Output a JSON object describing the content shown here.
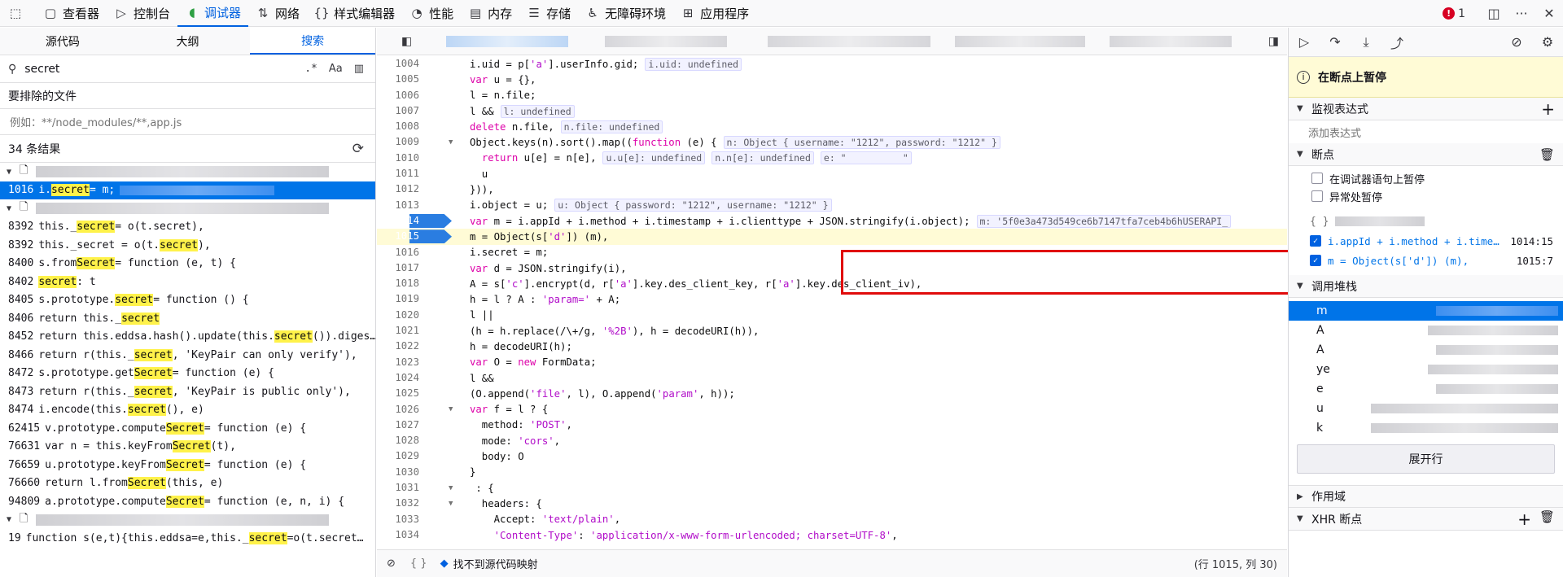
{
  "toolbar": {
    "tabs": [
      {
        "label": "查看器",
        "icon": "inspector-icon",
        "glyph": "▢"
      },
      {
        "label": "控制台",
        "icon": "console-icon",
        "glyph": "▷"
      },
      {
        "label": "调试器",
        "icon": "debugger-icon",
        "glyph": "◖"
      },
      {
        "label": "网络",
        "icon": "network-icon",
        "glyph": "⇅"
      },
      {
        "label": "样式编辑器",
        "icon": "style-editor-icon",
        "glyph": "{}"
      },
      {
        "label": "性能",
        "icon": "performance-icon",
        "glyph": "◔"
      },
      {
        "label": "内存",
        "icon": "memory-icon",
        "glyph": "▤"
      },
      {
        "label": "存储",
        "icon": "storage-icon",
        "glyph": "☰"
      },
      {
        "label": "无障碍环境",
        "icon": "accessibility-icon",
        "glyph": "♿"
      },
      {
        "label": "应用程序",
        "icon": "application-icon",
        "glyph": "⊞"
      }
    ],
    "error_count": "1"
  },
  "left": {
    "tabs": [
      "源代码",
      "大纲",
      "搜索"
    ],
    "search_value": "secret",
    "excluded_label": "要排除的文件",
    "excluded_placeholder": "例如：**/node_modules/**,app.js",
    "result_count": "34 条结果",
    "results": [
      {
        "type": "file"
      },
      {
        "ln": "1016",
        "pre": "i.",
        "hl": "secret",
        "post": " = m;",
        "sel": true
      },
      {
        "type": "file"
      },
      {
        "ln": "8392",
        "pre": "this._",
        "hl": "secret",
        "post": " = o(t.secret),"
      },
      {
        "ln": "8392",
        "pre": "this._secret = o(t.",
        "hl": "secret",
        "post": "),"
      },
      {
        "ln": "8400",
        "pre": "s.from",
        "hl": "Secret",
        "post": " = function (e, t) {"
      },
      {
        "ln": "8402",
        "pre": "",
        "hl": "secret",
        "post": ": t"
      },
      {
        "ln": "8405",
        "pre": "s.prototype.",
        "hl": "secret",
        "post": " = function () {"
      },
      {
        "ln": "8406",
        "pre": "return this._",
        "hl": "secret",
        "post": ""
      },
      {
        "ln": "8452",
        "pre": "return this.eddsa.hash().update(this.",
        "hl": "secret",
        "post": "()).diges…"
      },
      {
        "ln": "8466",
        "pre": "return r(this._",
        "hl": "secret",
        "post": ", 'KeyPair can only verify'),"
      },
      {
        "ln": "8472",
        "pre": "s.prototype.get",
        "hl": "Secret",
        "post": " = function (e) {"
      },
      {
        "ln": "8473",
        "pre": "return r(this._",
        "hl": "secret",
        "post": ", 'KeyPair is public only'),"
      },
      {
        "ln": "8474",
        "pre": "i.encode(this.",
        "hl": "secret",
        "post": "(), e)"
      },
      {
        "ln": "62415",
        "pre": "v.prototype.compute",
        "hl": "Secret",
        "post": " = function (e) {"
      },
      {
        "ln": "76631",
        "pre": "var n = this.keyFrom",
        "hl": "Secret",
        "post": "(t),"
      },
      {
        "ln": "76659",
        "pre": "u.prototype.keyFrom",
        "hl": "Secret",
        "post": " = function (e) {"
      },
      {
        "ln": "76660",
        "pre": "return l.from",
        "hl": "Secret",
        "post": "(this, e)"
      },
      {
        "ln": "94809",
        "pre": "a.prototype.compute",
        "hl": "Secret",
        "post": " = function (e, n, i) {"
      },
      {
        "type": "file"
      },
      {
        "ln": "19",
        "pre": "function s(e,t){this.eddsa=e,this._",
        "hl": "secret",
        "post": "=o(t.secret…"
      }
    ]
  },
  "code": {
    "lines": [
      {
        "n": "1004",
        "html": "i.uid = p['a'].userInfo.gid;",
        "pv": "i.uid: undefined"
      },
      {
        "n": "1005",
        "html": "var u = {},"
      },
      {
        "n": "1006",
        "html": "l = n.file;"
      },
      {
        "n": "1007",
        "html": "l &&",
        "pv": "l: undefined"
      },
      {
        "n": "1008",
        "html": "delete n.file,",
        "pv": "n.file: undefined"
      },
      {
        "n": "1009",
        "html": "Object.keys(n).sort().map((function (e) {",
        "pv": "n: Object { username: \"1212\", password: \"1212\" }",
        "fold": true
      },
      {
        "n": "1010",
        "html": "  return u[e] = n[e],",
        "pv": "u.u[e]: undefined",
        "pv2": "n.n[e]: undefined",
        "pv3": "e: \"          \""
      },
      {
        "n": "1011",
        "html": "  u"
      },
      {
        "n": "1012",
        "html": "})),"
      },
      {
        "n": "1013",
        "html": "i.object = u;",
        "pv": "u: Object { password: \"1212\", username: \"1212\" }"
      },
      {
        "n": "1014",
        "html": "var m = i.appId + i.method + i.timestamp + i.clienttype + JSON.stringify(i.object);",
        "pv": "m: '5f0e3a473d549ce6b7147tfa7ceb4b6hUSERAPI_",
        "bp": true
      },
      {
        "n": "1015",
        "html": "m = Object(s['d']) (m),",
        "bp": true,
        "cur": true
      },
      {
        "n": "1016",
        "html": "i.secret = m;"
      },
      {
        "n": "1017",
        "html": "var d = JSON.stringify(i),"
      },
      {
        "n": "1018",
        "html": "A = s['c'].encrypt(d, r['a'].key.des_client_key, r['a'].key.des_client_iv),"
      },
      {
        "n": "1019",
        "html": "h = l ? A : 'param=' + A;"
      },
      {
        "n": "1020",
        "html": "l ||"
      },
      {
        "n": "1021",
        "html": "(h = h.replace(/\\+/g, '%2B'), h = decodeURI(h)),"
      },
      {
        "n": "1022",
        "html": "h = decodeURI(h);"
      },
      {
        "n": "1023",
        "html": "var O = new FormData;"
      },
      {
        "n": "1024",
        "html": "l &&"
      },
      {
        "n": "1025",
        "html": "(O.append('file', l), O.append('param', h));"
      },
      {
        "n": "1026",
        "html": "var f = l ? {",
        "fold": true
      },
      {
        "n": "1027",
        "html": "  method: 'POST',"
      },
      {
        "n": "1028",
        "html": "  mode: 'cors',"
      },
      {
        "n": "1029",
        "html": "  body: O"
      },
      {
        "n": "1030",
        "html": "}"
      },
      {
        "n": "1031",
        "html": " : {",
        "fold": true
      },
      {
        "n": "1032",
        "html": "  headers: {",
        "fold": true
      },
      {
        "n": "1033",
        "html": "    Accept: 'text/plain',"
      },
      {
        "n": "1034",
        "html": "    'Content-Type': 'application/x-www-form-urlencoded; charset=UTF-8',"
      }
    ],
    "footer_mapping": "找不到源代码映射",
    "footer_pos": "(行 1015, 列 30)"
  },
  "right": {
    "paused_label": "在断点上暂停",
    "watch_label": "监视表达式",
    "watch_placeholder": "添加表达式",
    "breakpoints_label": "断点",
    "pause_debugger_stmt": "在调试器语句上暂停",
    "pause_exceptions": "异常处暂停",
    "bp_file": "{ }",
    "breakpoints": [
      {
        "text": "i.appId + i.method + i.time…",
        "loc": "1014:15"
      },
      {
        "text": "m = Object(s['d']) (m),",
        "loc": "1015:7"
      }
    ],
    "callstack_label": "调用堆栈",
    "frames": [
      "m",
      "A",
      "A",
      "ye",
      "e",
      "u",
      "k"
    ],
    "expand_label": "展开行",
    "scopes_label": "作用域",
    "xhr_label": "XHR 断点"
  }
}
